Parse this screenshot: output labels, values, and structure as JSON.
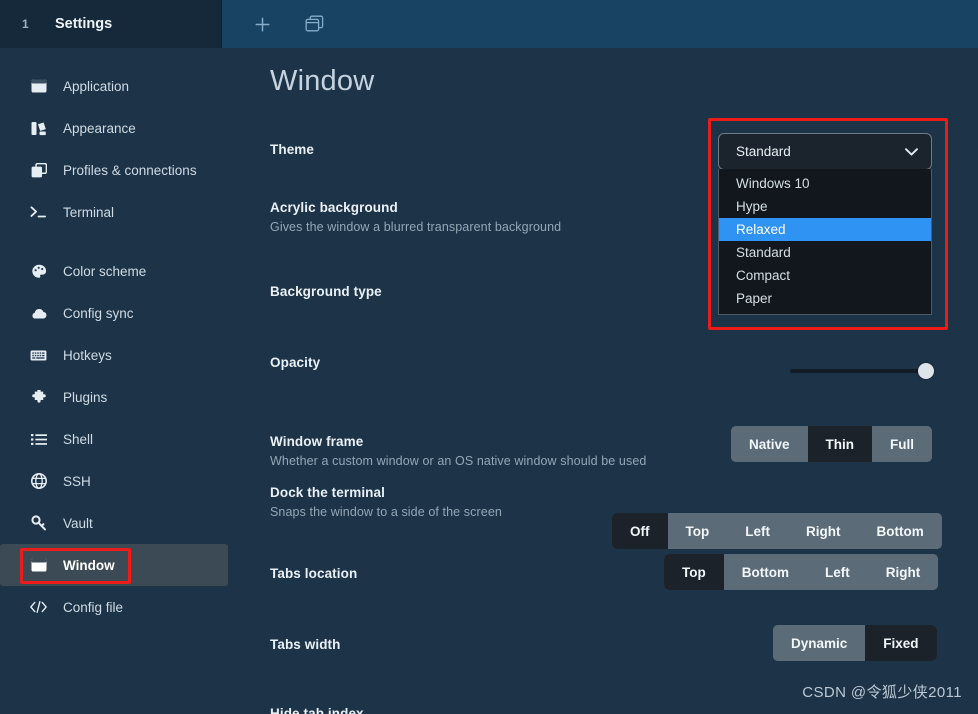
{
  "titlebar": {
    "tab_index": "1",
    "tab_title": "Settings",
    "new_tab_icon": "plus-icon",
    "split_icon": "window-split-icon"
  },
  "sidebar": {
    "items": [
      {
        "label": "Application",
        "icon": "application-window-icon",
        "selected": false
      },
      {
        "label": "Appearance",
        "icon": "appearance-paint-icon",
        "selected": false
      },
      {
        "label": "Profiles & connections",
        "icon": "profiles-copy-icon",
        "selected": false
      },
      {
        "label": "Terminal",
        "icon": "terminal-prompt-icon",
        "selected": false
      },
      {
        "label": "Color scheme",
        "icon": "palette-icon",
        "selected": false
      },
      {
        "label": "Config sync",
        "icon": "cloud-icon",
        "selected": false
      },
      {
        "label": "Hotkeys",
        "icon": "keyboard-icon",
        "selected": false
      },
      {
        "label": "Plugins",
        "icon": "puzzle-icon",
        "selected": false
      },
      {
        "label": "Shell",
        "icon": "list-icon",
        "selected": false
      },
      {
        "label": "SSH",
        "icon": "globe-icon",
        "selected": false
      },
      {
        "label": "Vault",
        "icon": "key-icon",
        "selected": false
      },
      {
        "label": "Window",
        "icon": "window-icon",
        "selected": true
      },
      {
        "label": "Config file",
        "icon": "code-brackets-icon",
        "selected": false
      }
    ]
  },
  "main": {
    "page_title": "Window",
    "settings": [
      {
        "label": "Theme",
        "desc": ""
      },
      {
        "label": "Acrylic background",
        "desc": "Gives the window a blurred transparent background"
      },
      {
        "label": "Background type",
        "desc": ""
      },
      {
        "label": "Opacity",
        "desc": ""
      },
      {
        "label": "Window frame",
        "desc": "Whether a custom window or an OS native window should be used"
      },
      {
        "label": "Dock the terminal",
        "desc": "Snaps the window to a side of the screen"
      },
      {
        "label": "Tabs location",
        "desc": ""
      },
      {
        "label": "Tabs width",
        "desc": ""
      },
      {
        "label": "Hide tab index",
        "desc": ""
      }
    ],
    "theme_select": {
      "value": "Standard",
      "chevron": "chevron-down-icon",
      "options": [
        {
          "label": "Windows 10",
          "highlighted": false
        },
        {
          "label": "Hype",
          "highlighted": false
        },
        {
          "label": "Relaxed",
          "highlighted": true
        },
        {
          "label": "Standard",
          "highlighted": false
        },
        {
          "label": "Compact",
          "highlighted": false
        },
        {
          "label": "Paper",
          "highlighted": false
        }
      ]
    },
    "opacity_slider": {
      "value": 100
    },
    "window_frame": {
      "options": [
        {
          "label": "Native",
          "active": false
        },
        {
          "label": "Thin",
          "active": true
        },
        {
          "label": "Full",
          "active": false
        }
      ]
    },
    "dock_terminal": {
      "options": [
        {
          "label": "Off",
          "active": true
        },
        {
          "label": "Top",
          "active": false
        },
        {
          "label": "Left",
          "active": false
        },
        {
          "label": "Right",
          "active": false
        },
        {
          "label": "Bottom",
          "active": false
        }
      ]
    },
    "tabs_location": {
      "options": [
        {
          "label": "Top",
          "active": true
        },
        {
          "label": "Bottom",
          "active": false
        },
        {
          "label": "Left",
          "active": false
        },
        {
          "label": "Right",
          "active": false
        }
      ]
    },
    "tabs_width": {
      "options": [
        {
          "label": "Dynamic",
          "active": false
        },
        {
          "label": "Fixed",
          "active": true
        }
      ]
    }
  },
  "annotations": {
    "accent_color": "#ee1b1b"
  },
  "watermark": {
    "text": "CSDN @令狐少侠2011"
  }
}
